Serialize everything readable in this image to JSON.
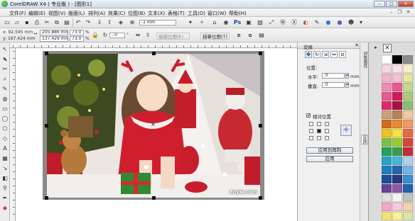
{
  "window": {
    "title": "CorelDRAW X4 ( 专业版 ) - [图形1]",
    "minimize": "–",
    "maximize": "□",
    "close": "✕"
  },
  "menu": [
    "文件(F)",
    "编辑(E)",
    "视图(V)",
    "版面(L)",
    "排列(A)",
    "效果(C)",
    "位图(B)",
    "文本(X)",
    "表格(T)",
    "工具(O)",
    "窗口(W)",
    "帮助(H)"
  ],
  "toolbar1": {
    "zoom_value": "-1 mm"
  },
  "property_bar": {
    "x": "x:  92.595 mm",
    "y": "y:  167.424 mm",
    "width": "205.886 mm",
    "height": "137.429 mm",
    "scale_w": "73.0",
    "scale_h": "73.0",
    "percent": "%",
    "angle": "-.0",
    "angle_unit": "°",
    "edit_bitmap": "编辑位图(E)...",
    "trace_bitmap": "描摹位图(T)"
  },
  "docker": {
    "title": "变换",
    "position_label": "位置:",
    "h_label": "水平:",
    "h_value": ".0",
    "v_label": "垂直:",
    "v_value": ".0",
    "unit": "mm",
    "relative_label": "相对位置",
    "relative_checked": "✔",
    "apply_copy": "应用到再制",
    "apply": "应用"
  },
  "side_tabs": [
    "对象属性",
    "变换"
  ],
  "photo": {
    "watermark": "anyw.com"
  },
  "palette": {
    "columns": [
      [
        "#ffffff",
        "#f4d6e4",
        "#f2b4cc",
        "#f08bb1",
        "#e8598f",
        "#e0296c",
        "#c8a07a",
        "#d96a1a",
        "#f0c419",
        "#7cc242",
        "#22a35a",
        "#27a3c9",
        "#1a7fc4",
        "#1b4e9c",
        "#6a3f98",
        "#e0e0e0",
        "#f4a6c8",
        "#f3e27a"
      ],
      [
        "#000000",
        "#f9e0e8",
        "#f6c0d3",
        "#e85b8a",
        "#d41a5b",
        "#a51345",
        "#b78353",
        "#e68a2e",
        "#f7e23c",
        "#99cc33",
        "#3a9f4d",
        "#45b8d8",
        "#2a63b0",
        "#28387a",
        "#8b5aa6",
        "#f4f4f4",
        "#f7c9dc",
        "#f9f09b"
      ],
      [
        "#8c8c8c",
        "#f6f0c8",
        "#e4e6a2",
        "#c8d888",
        "#a8cc7a",
        "#88c070",
        "#f4c6a2",
        "#f09a66",
        "#e86a3a",
        "#d8453a",
        "#c22d3a",
        "#b0d0ec",
        "#78b4e0",
        "#3a8fd2",
        "#1d63ad",
        "#c2c2c2",
        "#f5d0b0",
        "#d8e8a8"
      ]
    ]
  }
}
